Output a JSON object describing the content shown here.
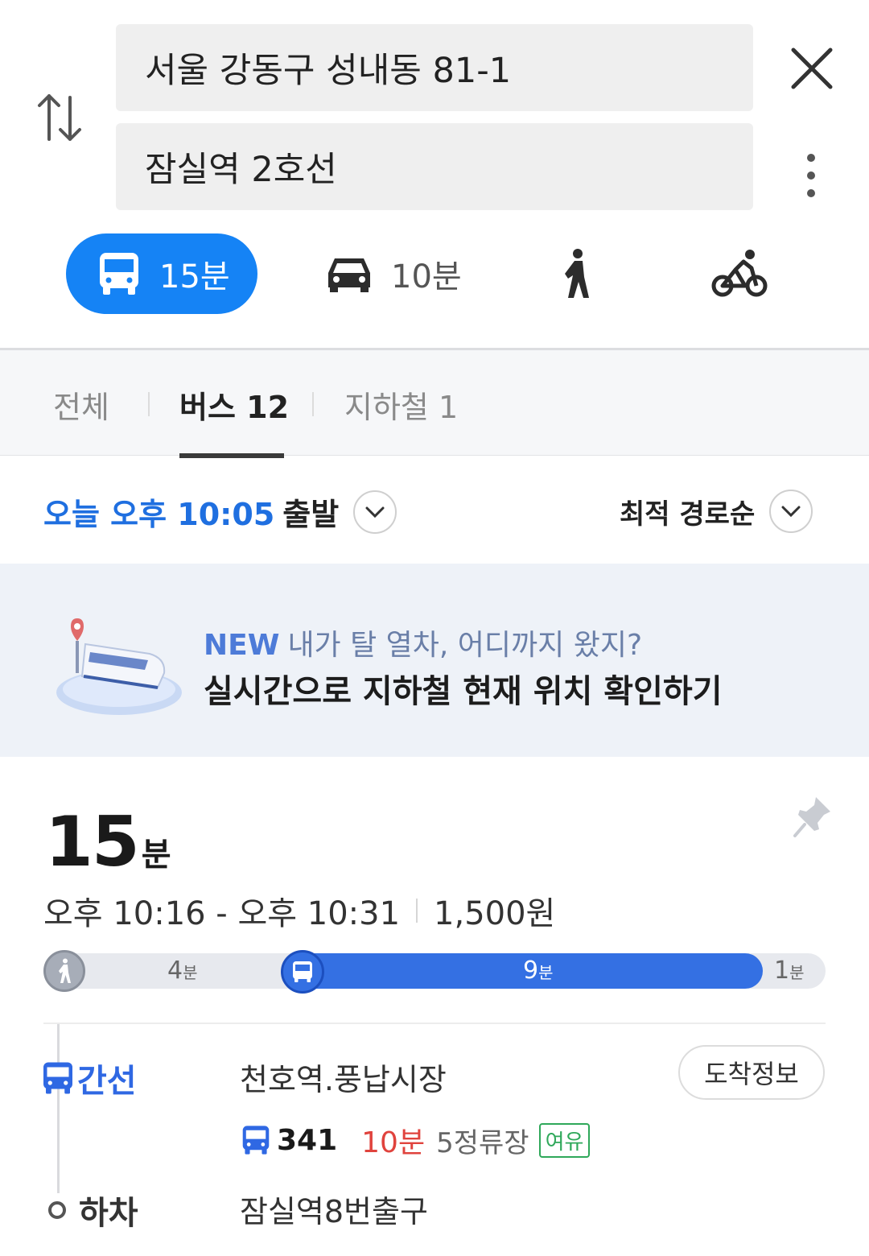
{
  "search": {
    "origin": "서울 강동구 성내동 81-1",
    "destination": "잠실역 2호선"
  },
  "modes": {
    "transit": {
      "icon": "bus-icon",
      "label": "15분"
    },
    "car": {
      "icon": "car-icon",
      "label": "10분"
    },
    "walk": {
      "icon": "walk-icon"
    },
    "bike": {
      "icon": "bike-icon"
    }
  },
  "tabs": [
    {
      "label": "전체"
    },
    {
      "label": "버스 12"
    },
    {
      "label": "지하철 1"
    }
  ],
  "active_tab": 1,
  "departure": {
    "time": "오늘 오후 10:05",
    "suffix": "출발"
  },
  "sort": {
    "label": "최적 경로순"
  },
  "banner": {
    "new_tag": "NEW",
    "headline": "내가 탈 열차, 어디까지 왔지?",
    "cta": "실시간으로 지하철 현재 위치 확인하기"
  },
  "route": {
    "duration_num": "15",
    "duration_unit": "분",
    "time_range": "오후 10:16 - 오후 10:31",
    "fare": "1,500원",
    "segments": [
      {
        "type": "walk",
        "num": "4",
        "unit": "분"
      },
      {
        "type": "bus",
        "num": "9",
        "unit": "분"
      },
      {
        "type": "walk",
        "num": "1",
        "unit": "분"
      }
    ],
    "board": {
      "type_label": "간선",
      "station": "천호역.풍납시장",
      "arrival_button": "도착정보",
      "bus_number": "341",
      "eta": "10분",
      "stops": "5정류장",
      "crowd_badge": "여유"
    },
    "alight": {
      "label": "하차",
      "station": "잠실역8번출구"
    }
  },
  "colors": {
    "accent": "#1583f5",
    "bus_blue": "#3470e3",
    "eta_red": "#e0433d",
    "crowd_green": "#2fa85a"
  }
}
